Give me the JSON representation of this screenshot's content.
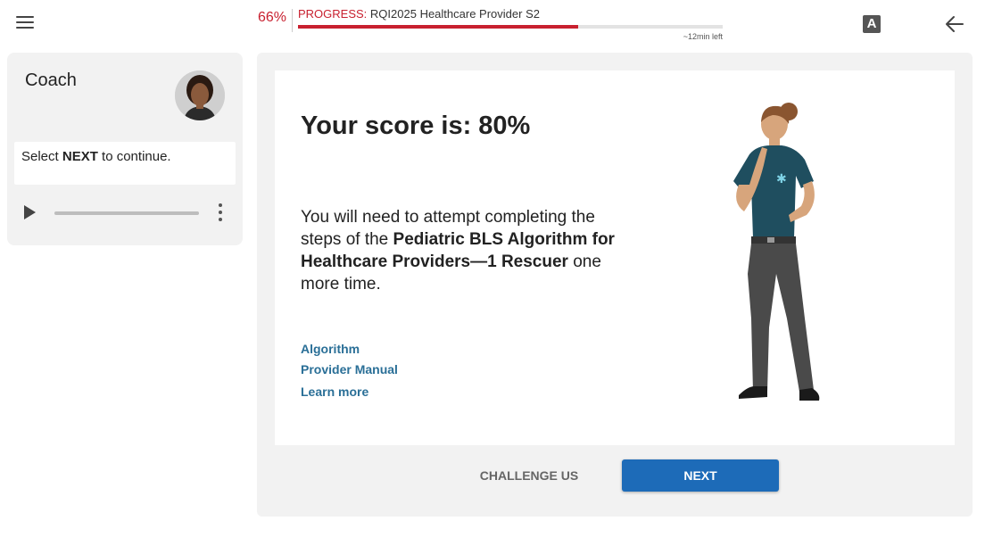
{
  "header": {
    "progress_percent_label": "66%",
    "progress_prefix": "PROGRESS:",
    "course_title": "RQI2025 Healthcare Provider S2",
    "progress_fraction": 0.66,
    "time_left": "~12min  left",
    "font_button_label": "A",
    "accent_color": "#c8202f"
  },
  "coach": {
    "title": "Coach",
    "message_pre": "Select ",
    "message_bold": "NEXT",
    "message_post": " to continue."
  },
  "main": {
    "score_text": "Your score is: 80%",
    "desc_pre": "You will need to attempt completing the steps of the ",
    "desc_bold": "Pediatric BLS Algorithm for Healthcare Providers—1 Rescuer",
    "desc_post": " one more time.",
    "links": [
      "Algorithm",
      "Provider Manual",
      "Learn more"
    ],
    "link_color": "#2a6f97"
  },
  "actions": {
    "challenge_label": "CHALLENGE US",
    "next_label": "NEXT",
    "next_color": "#1d6bb8"
  }
}
